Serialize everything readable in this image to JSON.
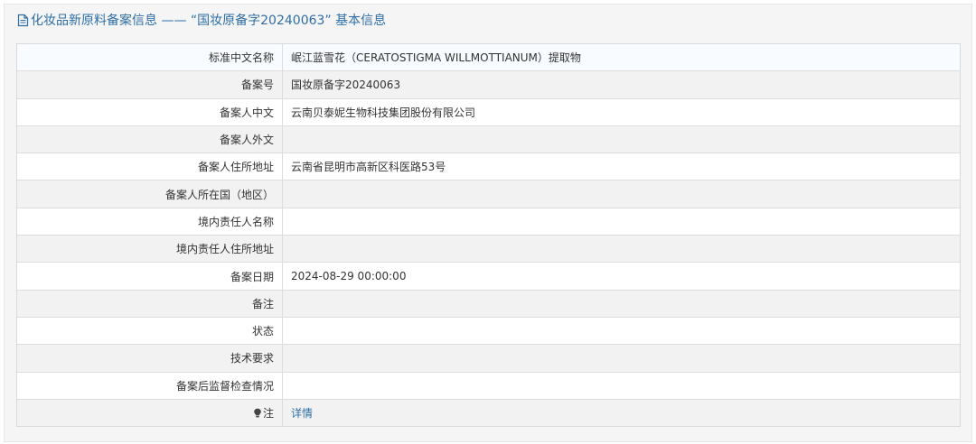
{
  "header": {
    "title": "化妆品新原料备案信息 —— “国妆原备字20240063” 基本信息",
    "icon": "document-icon",
    "color": "#2f6ea5"
  },
  "rows": [
    {
      "label": "标准中文名称",
      "value": "岷江蓝雪花（CERATOSTIGMA WILLMOTTIANUM）提取物"
    },
    {
      "label": "备案号",
      "value": "国妆原备字20240063"
    },
    {
      "label": "备案人中文",
      "value": "云南贝泰妮生物科技集团股份有限公司"
    },
    {
      "label": "备案人外文",
      "value": ""
    },
    {
      "label": "备案人住所地址",
      "value": "云南省昆明市高新区科医路53号"
    },
    {
      "label": "备案人所在国（地区）",
      "value": ""
    },
    {
      "label": "境内责任人名称",
      "value": ""
    },
    {
      "label": "境内责任人住所地址",
      "value": ""
    },
    {
      "label": "备案日期",
      "value": "2024-08-29 00:00:00"
    },
    {
      "label": "备注",
      "value": ""
    },
    {
      "label": "状态",
      "value": ""
    },
    {
      "label": "技术要求",
      "value": ""
    },
    {
      "label": "备案后监督检查情况",
      "value": ""
    }
  ],
  "note_row": {
    "label": "注",
    "icon": "lightbulb-icon",
    "link_text": "详情"
  },
  "colors": {
    "link": "#2f6ea5",
    "panel_bg": "#f5f5f5",
    "row_alt": "#f2f2f2",
    "border": "#dddddd"
  }
}
